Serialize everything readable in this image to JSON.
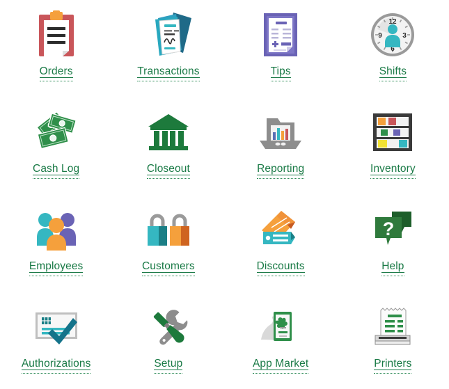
{
  "page": {
    "background_color": "#ffffff",
    "link_color": "#1a7a46",
    "columns": 4,
    "rows": 4
  },
  "tiles": [
    {
      "label": "Orders",
      "icon": "clipboard-orders-icon"
    },
    {
      "label": "Transactions",
      "icon": "documents-transactions-icon"
    },
    {
      "label": "Tips",
      "icon": "receipt-tips-icon"
    },
    {
      "label": "Shifts",
      "icon": "clock-person-shifts-icon"
    },
    {
      "label": "Cash Log",
      "icon": "banknotes-cash-log-icon"
    },
    {
      "label": "Closeout",
      "icon": "bank-building-closeout-icon"
    },
    {
      "label": "Reporting",
      "icon": "folder-barchart-reporting-icon"
    },
    {
      "label": "Inventory",
      "icon": "shelf-boxes-inventory-icon"
    },
    {
      "label": "Employees",
      "icon": "people-group-employees-icon"
    },
    {
      "label": "Customers",
      "icon": "padlocks-customers-icon"
    },
    {
      "label": "Discounts",
      "icon": "pencil-tag-discounts-icon"
    },
    {
      "label": "Help",
      "icon": "question-speech-help-icon"
    },
    {
      "label": "Authorizations",
      "icon": "credit-card-check-authorizations-icon"
    },
    {
      "label": "Setup",
      "icon": "wrench-screwdriver-setup-icon"
    },
    {
      "label": "App Market",
      "icon": "hand-phone-app-market-icon"
    },
    {
      "label": "Printers",
      "icon": "receipt-printer-printers-icon"
    }
  ],
  "colors": {
    "red": "#c9565a",
    "orange": "#f5a03c",
    "teal": "#35b7c1",
    "dark_teal": "#1b7f86",
    "blue": "#2f7fa8",
    "purple": "#6a63b5",
    "green": "#2e8b4a",
    "dark_green": "#1d6b37",
    "gray": "#9a9a9a",
    "dark_gray": "#3a3a3a",
    "yellow": "#f2e234"
  }
}
